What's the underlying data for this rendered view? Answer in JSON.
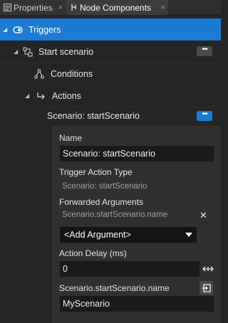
{
  "tabs": [
    {
      "label": "Properties",
      "close": "×"
    },
    {
      "label": "Node Components",
      "close": "×"
    }
  ],
  "tree": {
    "triggers": "Triggers",
    "start_scenario": "Start scenario",
    "conditions": "Conditions",
    "actions": "Actions",
    "action_item": "Scenario: startScenario",
    "more": "•••"
  },
  "panel": {
    "name_label": "Name",
    "name_value": "Scenario: startScenario",
    "type_label": "Trigger Action Type",
    "type_value": "Scenario: startScenario",
    "forwarded_label": "Forwarded Arguments",
    "forwarded_value": "Scenario.startScenario.name",
    "remove_glyph": "✕",
    "add_argument": "<Add Argument>",
    "delay_label": "Action Delay (ms)",
    "delay_value": "0",
    "name_arg_label": "Scenario.startScenario.name",
    "name_arg_value": "MyScenario"
  },
  "colors": {
    "selection": "#1b7ad1",
    "background": "#252525",
    "panel": "#303030"
  }
}
